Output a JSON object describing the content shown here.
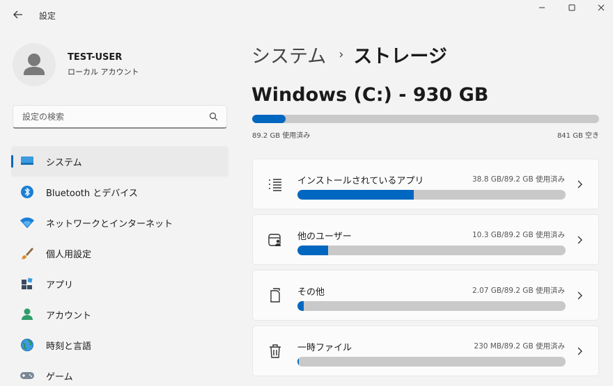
{
  "window": {
    "title": "設定"
  },
  "profile": {
    "name": "TEST-USER",
    "account_type": "ローカル アカウント"
  },
  "search": {
    "placeholder": "設定の検索"
  },
  "sidebar": {
    "items": [
      {
        "label": "システム",
        "icon": "system-icon",
        "active": true
      },
      {
        "label": "Bluetooth とデバイス",
        "icon": "bluetooth-icon",
        "active": false
      },
      {
        "label": "ネットワークとインターネット",
        "icon": "wifi-icon",
        "active": false
      },
      {
        "label": "個人用設定",
        "icon": "brush-icon",
        "active": false
      },
      {
        "label": "アプリ",
        "icon": "apps-icon",
        "active": false
      },
      {
        "label": "アカウント",
        "icon": "account-icon",
        "active": false
      },
      {
        "label": "時刻と言語",
        "icon": "time-language-icon",
        "active": false
      },
      {
        "label": "ゲーム",
        "icon": "gamepad-icon",
        "active": false
      }
    ]
  },
  "breadcrumb": {
    "parent": "システム",
    "separator": "›",
    "current": "ストレージ"
  },
  "drive": {
    "title": "Windows (C:) - 930 GB",
    "used_fraction": 0.096,
    "used_label": "89.2 GB 使用済み",
    "free_label": "841 GB 空き"
  },
  "categories": [
    {
      "name": "インストールされているアプリ",
      "usage": "38.8 GB/89.2 GB 使用済み",
      "fraction": 0.435,
      "icon": "apps-list-icon"
    },
    {
      "name": "他のユーザー",
      "usage": "10.3 GB/89.2 GB 使用済み",
      "fraction": 0.115,
      "icon": "other-users-icon"
    },
    {
      "name": "その他",
      "usage": "2.07 GB/89.2 GB 使用済み",
      "fraction": 0.023,
      "icon": "other-files-icon"
    },
    {
      "name": "一時ファイル",
      "usage": "230 MB/89.2 GB 使用済み",
      "fraction": 0.0026,
      "icon": "trash-icon"
    }
  ],
  "colors": {
    "accent": "#0067c0",
    "bar_track": "#c9c9c9"
  }
}
